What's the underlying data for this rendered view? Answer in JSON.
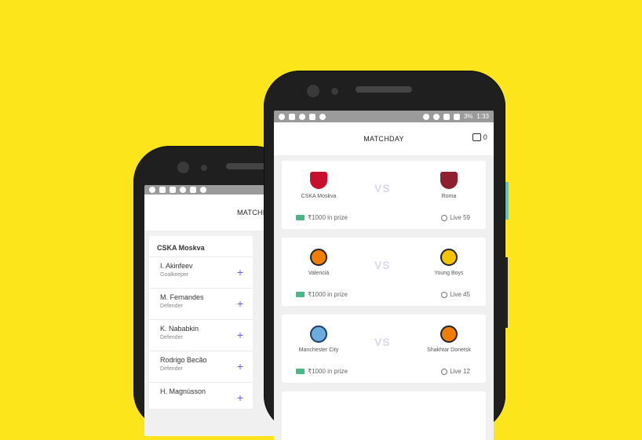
{
  "background_color": "#fde51b",
  "back_phone": {
    "status_icons": [
      "whatsapp-icon",
      "message-icon",
      "image-icon",
      "game-icon",
      "play-icon",
      "circle-icon"
    ],
    "appbar_title": "MATCHD",
    "club": "CSKA Moskva",
    "players": [
      {
        "name": "I. Akinfeev",
        "position": "Goalkeeper"
      },
      {
        "name": "M. Fernandes",
        "position": "Defender"
      },
      {
        "name": "K. Nababkin",
        "position": "Defender"
      },
      {
        "name": "Rodrigo Becão",
        "position": "Defender"
      },
      {
        "name": "H. Magnússon",
        "position": ""
      }
    ],
    "add_symbol": "+"
  },
  "front_phone": {
    "status_time": "1:33",
    "status_battery": "3%",
    "appbar_title": "MATCHDAY",
    "wallet_count": "0",
    "vs_label": "VS",
    "matches": [
      {
        "home": "CSKA Moskva",
        "away": "Roma",
        "prize": "₹1000 in prize",
        "live": "Live 59",
        "home_color": "#c8102e",
        "away_color": "#8e1f2f"
      },
      {
        "home": "Valenciá",
        "away": "Young Boys",
        "prize": "₹1000 in prize",
        "live": "Live 45",
        "home_color": "#ee7f00",
        "away_color": "#f5c400"
      },
      {
        "home": "Manchester City",
        "away": "Shakhtar Donetsk",
        "prize": "₹1000 in prize",
        "live": "Live 12",
        "home_color": "#6cabdd",
        "away_color": "#f07e00"
      }
    ]
  }
}
